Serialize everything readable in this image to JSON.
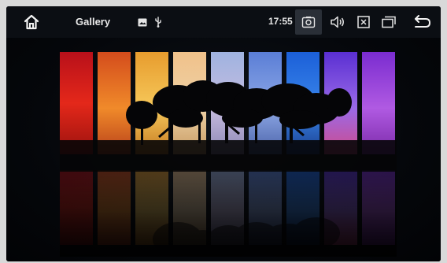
{
  "statusbar": {
    "home_icon": "home-icon",
    "app_title": "Gallery",
    "gallery_icon": "image-icon",
    "usb_icon": "usb-icon",
    "time": "17:55",
    "camera_icon": "camera-icon",
    "volume_icon": "volume-icon",
    "close_app_icon": "close-box-icon",
    "recent_icon": "recent-apps-icon",
    "back_icon": "back-arrow-icon"
  },
  "photo": {
    "strip_colors": [
      "#d4161a",
      "#e1601e",
      "#efb23a",
      "#e9b982",
      "#b7a9d6",
      "#7e96d8",
      "#2a6de0",
      "#7a3fd8",
      "#9a3ad6"
    ]
  }
}
